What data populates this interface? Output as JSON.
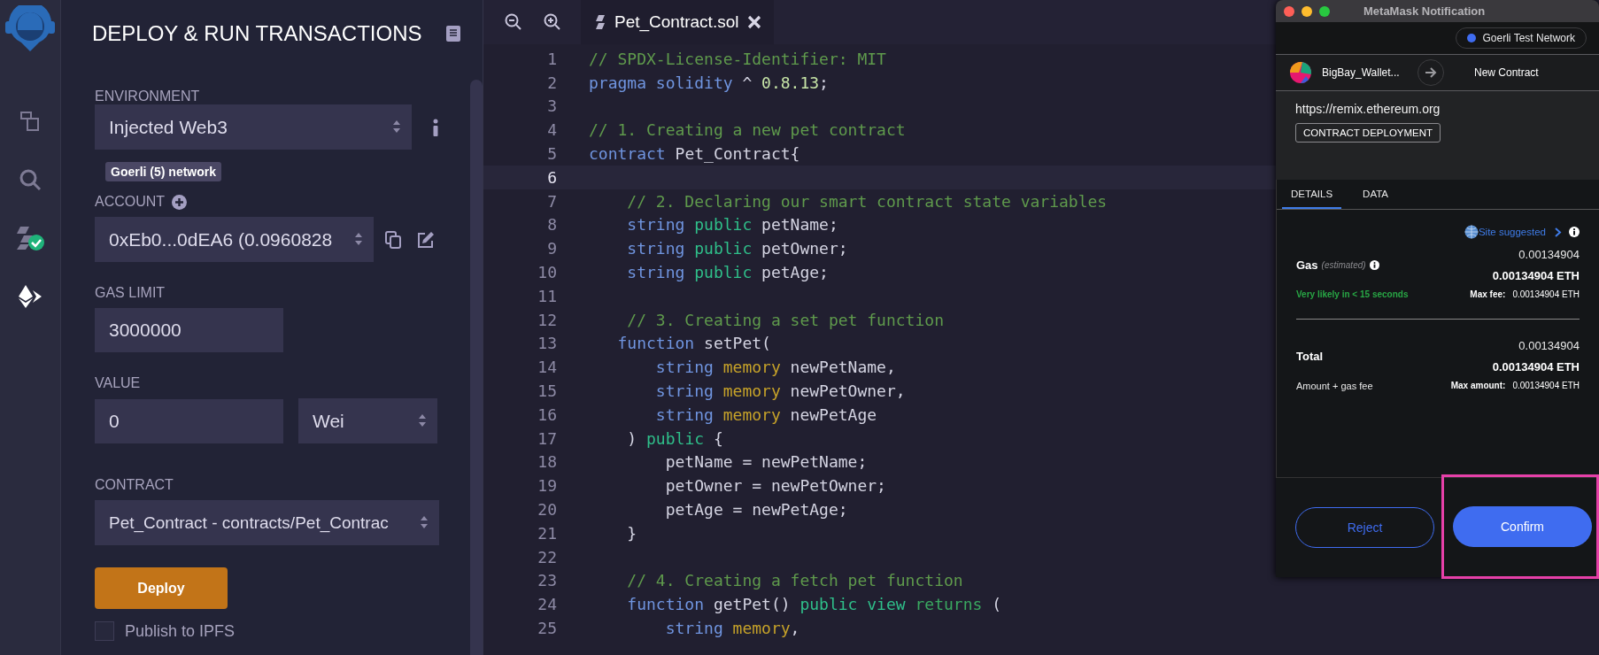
{
  "icon_rail": {
    "items": [
      {
        "kind": "files",
        "selected": false
      },
      {
        "kind": "search",
        "selected": false
      },
      {
        "kind": "compiler",
        "selected": false,
        "compiled": true
      },
      {
        "kind": "deploy",
        "selected": true
      }
    ]
  },
  "panel": {
    "title": "DEPLOY & RUN TRANSACTIONS",
    "environment": {
      "label": "ENVIRONMENT",
      "value": "Injected Web3",
      "network_badge": "Goerli (5) network"
    },
    "account": {
      "label": "ACCOUNT",
      "value": "0xEb0...0dEA6 (0.0960828"
    },
    "gas_limit": {
      "label": "GAS LIMIT",
      "value": "3000000"
    },
    "value": {
      "label": "VALUE",
      "value": "0",
      "unit": "Wei"
    },
    "contract": {
      "label": "CONTRACT",
      "value": "Pet_Contract - contracts/Pet_Contrac"
    },
    "deploy_button": "Deploy",
    "publish": {
      "label": "Publish to IPFS",
      "checked": false
    }
  },
  "editor": {
    "tabs": [
      {
        "label": "Pet_Contract.sol",
        "selected": true
      }
    ],
    "lines": [
      {
        "number": "1",
        "active": false,
        "tokens": [
          {
            "kind": "comment",
            "t": "// SPDX-License-Identifier: MIT"
          }
        ]
      },
      {
        "number": "2",
        "active": false,
        "tokens": [
          {
            "kind": "keyword",
            "t": "pragma solidity"
          },
          {
            "kind": "plain",
            "t": " ^ "
          },
          {
            "kind": "number",
            "t": "0.8.13"
          },
          {
            "kind": "plain",
            "t": ";"
          }
        ]
      },
      {
        "number": "3",
        "active": false
      },
      {
        "number": "4",
        "active": false,
        "tokens": [
          {
            "kind": "comment",
            "t": "// 1. Creating a new pet contract"
          }
        ]
      },
      {
        "number": "5",
        "active": false,
        "tokens": [
          {
            "kind": "keyword",
            "t": "contract"
          },
          {
            "kind": "plain",
            "t": " Pet_Contract{"
          }
        ]
      },
      {
        "number": "6",
        "active": true
      },
      {
        "number": "7",
        "active": false,
        "tokens": [
          {
            "kind": "comment",
            "t": "    // 2. Declaring our smart contract state variables"
          }
        ]
      },
      {
        "number": "8",
        "active": false,
        "tokens": [
          {
            "kind": "keyword",
            "t": "    string"
          },
          {
            "kind": "visibility",
            "t": " public"
          },
          {
            "kind": "plain",
            "t": " petName;"
          }
        ]
      },
      {
        "number": "9",
        "active": false,
        "tokens": [
          {
            "kind": "keyword",
            "t": "    string"
          },
          {
            "kind": "visibility",
            "t": " public"
          },
          {
            "kind": "plain",
            "t": " petOwner;"
          }
        ]
      },
      {
        "number": "10",
        "active": false,
        "tokens": [
          {
            "kind": "keyword",
            "t": "    string"
          },
          {
            "kind": "visibility",
            "t": " public"
          },
          {
            "kind": "plain",
            "t": " petAge;"
          }
        ]
      },
      {
        "number": "11",
        "active": false
      },
      {
        "number": "12",
        "active": false,
        "tokens": [
          {
            "kind": "comment",
            "t": "    // 3. Creating a set pet function"
          }
        ]
      },
      {
        "number": "13",
        "active": false,
        "tokens": [
          {
            "kind": "keyword",
            "t": "   function"
          },
          {
            "kind": "plain",
            "t": " setPet("
          }
        ]
      },
      {
        "number": "14",
        "active": false,
        "tokens": [
          {
            "kind": "keyword",
            "t": "       string"
          },
          {
            "kind": "storage",
            "t": " memory"
          },
          {
            "kind": "plain",
            "t": " newPetName,"
          }
        ]
      },
      {
        "number": "15",
        "active": false,
        "tokens": [
          {
            "kind": "keyword",
            "t": "       string"
          },
          {
            "kind": "storage",
            "t": " memory"
          },
          {
            "kind": "plain",
            "t": " newPetOwner,"
          }
        ]
      },
      {
        "number": "16",
        "active": false,
        "tokens": [
          {
            "kind": "keyword",
            "t": "       string"
          },
          {
            "kind": "storage",
            "t": " memory"
          },
          {
            "kind": "plain",
            "t": " newPetAge"
          }
        ]
      },
      {
        "number": "17",
        "active": false,
        "tokens": [
          {
            "kind": "plain",
            "t": "    ) "
          },
          {
            "kind": "visibility",
            "t": "public"
          },
          {
            "kind": "plain",
            "t": " {"
          }
        ]
      },
      {
        "number": "18",
        "active": false,
        "tokens": [
          {
            "kind": "plain",
            "t": "        petName = newPetName;"
          }
        ]
      },
      {
        "number": "19",
        "active": false,
        "tokens": [
          {
            "kind": "plain",
            "t": "        petOwner = newPetOwner;"
          }
        ]
      },
      {
        "number": "20",
        "active": false,
        "tokens": [
          {
            "kind": "plain",
            "t": "        petAge = newPetAge;"
          }
        ]
      },
      {
        "number": "21",
        "active": false,
        "tokens": [
          {
            "kind": "plain",
            "t": "    }"
          }
        ]
      },
      {
        "number": "22",
        "active": false
      },
      {
        "number": "23",
        "active": false,
        "tokens": [
          {
            "kind": "comment",
            "t": "    // 4. Creating a fetch pet function"
          }
        ]
      },
      {
        "number": "24",
        "active": false,
        "tokens": [
          {
            "kind": "keyword",
            "t": "    function"
          },
          {
            "kind": "plain",
            "t": " getPet() "
          },
          {
            "kind": "visibility",
            "t": "public view"
          },
          {
            "kind": "returns",
            "t": " returns"
          },
          {
            "kind": "plain",
            "t": " ("
          }
        ]
      },
      {
        "number": "25",
        "active": false,
        "tokens": [
          {
            "kind": "keyword",
            "t": "        string"
          },
          {
            "kind": "storage",
            "t": " memory"
          },
          {
            "kind": "plain",
            "t": ","
          }
        ]
      }
    ]
  },
  "metamask": {
    "title": "MetaMask Notification",
    "network": "Goerli Test Network",
    "from": "BigBay_Wallet...",
    "to": "New Contract",
    "origin": "https://remix.ethereum.org",
    "badge": "CONTRACT DEPLOYMENT",
    "tabs": [
      {
        "label": "DETAILS",
        "selected": true
      },
      {
        "label": "DATA",
        "selected": false
      }
    ],
    "site_suggested": "Site suggested",
    "gas": {
      "label": "Gas",
      "hint": "(estimated)",
      "amount": "0.00134904",
      "amount_eth": "0.00134904 ETH",
      "speed": "Very likely in < 15 seconds",
      "max_label": "Max fee:",
      "max_value": "0.00134904 ETH"
    },
    "total": {
      "label": "Total",
      "amount": "0.00134904",
      "amount_eth": "0.00134904 ETH",
      "sub": "Amount + gas fee",
      "max_label": "Max amount:",
      "max_value": "0.00134904 ETH"
    },
    "buttons": [
      {
        "label": "Reject",
        "kind": "secondary",
        "highlighted": false
      },
      {
        "label": "Confirm",
        "kind": "primary",
        "highlighted": true
      }
    ]
  }
}
